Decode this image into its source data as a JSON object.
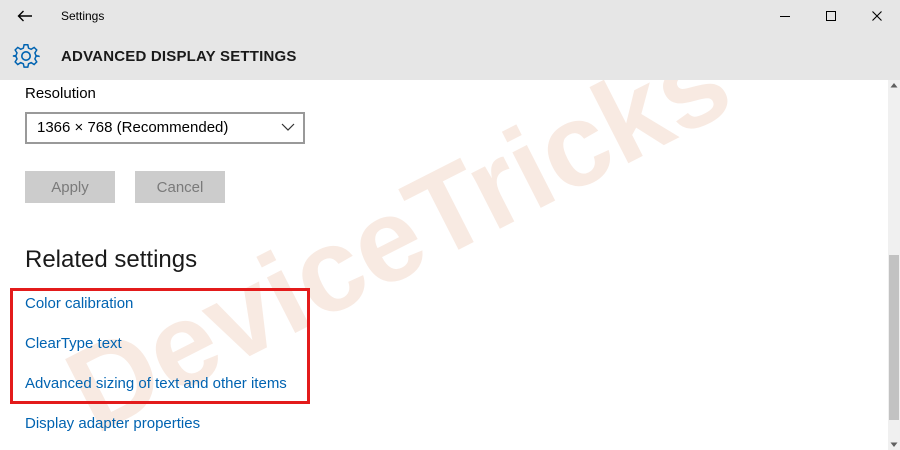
{
  "window": {
    "title": "Settings"
  },
  "header": {
    "title": "ADVANCED DISPLAY SETTINGS",
    "icon": "gear-icon"
  },
  "resolution": {
    "label": "Resolution",
    "selected": "1366 × 768 (Recommended)"
  },
  "buttons": {
    "apply": "Apply",
    "cancel": "Cancel"
  },
  "related": {
    "heading": "Related settings",
    "links": [
      "Color calibration",
      "ClearType text",
      "Advanced sizing of text and other items",
      "Display adapter properties"
    ]
  },
  "watermark": {
    "text": "DeviceTricks"
  },
  "colors": {
    "accent": "#0063b1",
    "highlight": "#e31b1b",
    "titlebar": "#e6e6e6"
  }
}
